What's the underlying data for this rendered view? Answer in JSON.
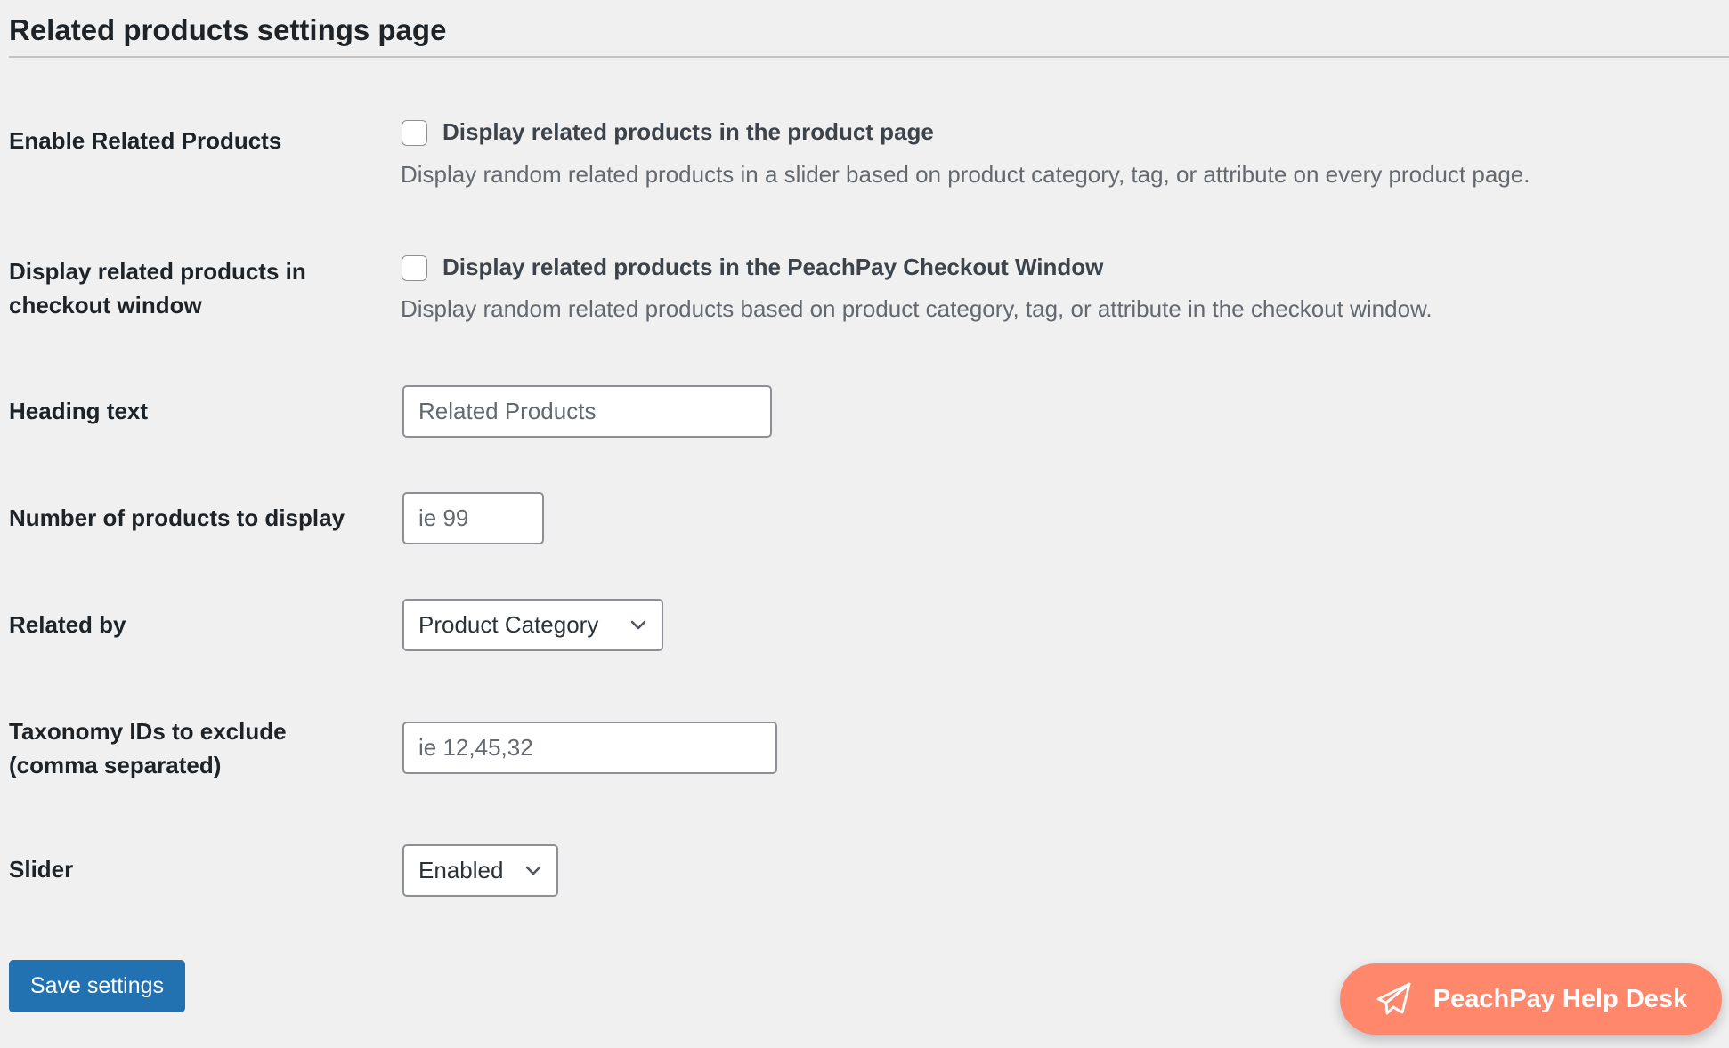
{
  "page": {
    "title": "Related products settings page"
  },
  "settings": {
    "enable_related": {
      "label": "Enable Related Products",
      "checkbox_label": "Display related products in the product page",
      "checked": false,
      "description": "Display random related products in a slider based on product category, tag, or attribute on every product page."
    },
    "checkout_window": {
      "label_line1": "Display related products in",
      "label_line2": "checkout window",
      "checkbox_label": "Display related products in the PeachPay Checkout Window",
      "checked": false,
      "description": "Display random related products based on product category, tag, or attribute in the checkout window."
    },
    "heading_text": {
      "label": "Heading text",
      "value": "",
      "placeholder": "Related Products"
    },
    "num_products": {
      "label": "Number of products to display",
      "value": "",
      "placeholder": "ie 99"
    },
    "related_by": {
      "label": "Related by",
      "selected": "Product Category"
    },
    "taxonomy_exclude": {
      "label_line1": "Taxonomy IDs to exclude",
      "label_line2": "(comma separated)",
      "value": "",
      "placeholder": "ie 12,45,32"
    },
    "slider": {
      "label": "Slider",
      "selected": "Enabled"
    }
  },
  "actions": {
    "save_label": "Save settings"
  },
  "help_desk": {
    "label": "PeachPay Help Desk",
    "icon": "paper-plane-icon"
  },
  "colors": {
    "background": "#f0f0f1",
    "primary_button": "#2271b1",
    "help_desk": "#ff876c"
  }
}
